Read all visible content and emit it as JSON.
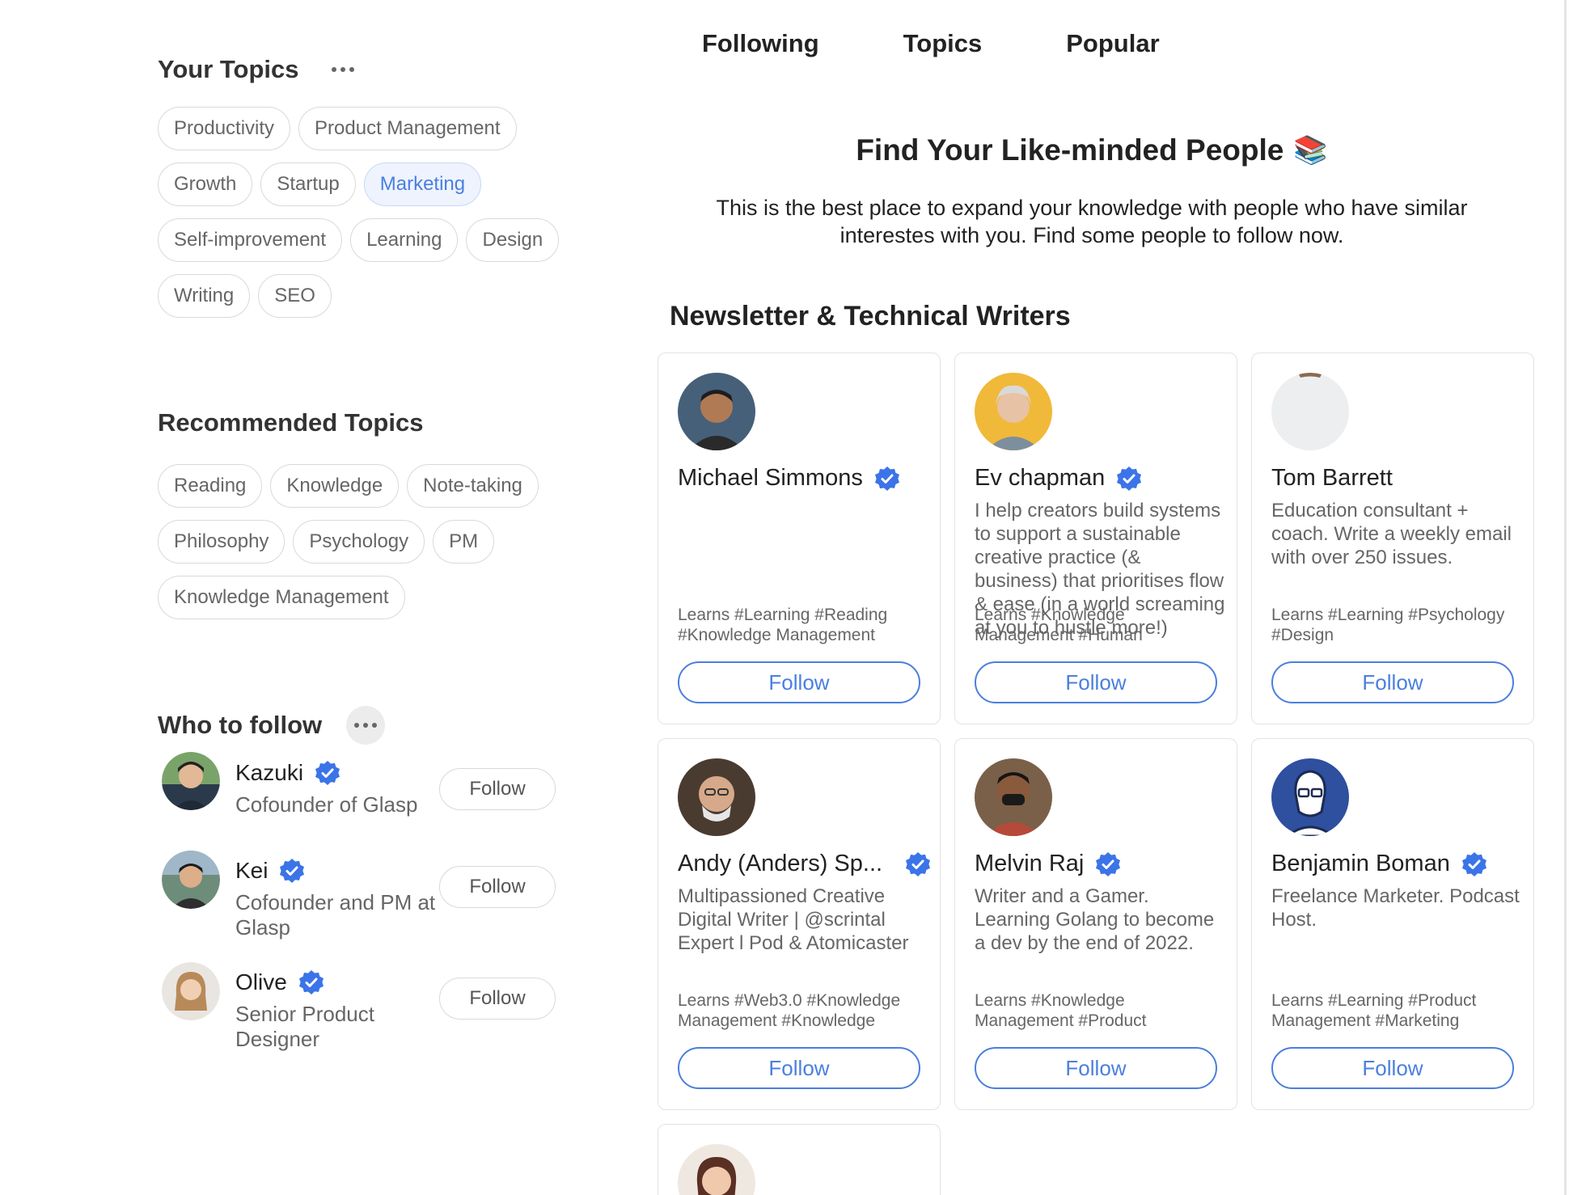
{
  "tabs": [
    "Following",
    "Topics",
    "Popular"
  ],
  "your_topics": {
    "title": "Your Topics",
    "chips": [
      "Productivity",
      "Product Management",
      "Growth",
      "Startup",
      "Marketing",
      "Self-improvement",
      "Learning",
      "Design",
      "Writing",
      "SEO"
    ],
    "active": "Marketing"
  },
  "recommended_topics": {
    "title": "Recommended Topics",
    "chips": [
      "Reading",
      "Knowledge",
      "Note-taking",
      "Philosophy",
      "Psychology",
      "PM",
      "Knowledge Management"
    ]
  },
  "who_to_follow": {
    "title": "Who to follow",
    "people": [
      {
        "name": "Kazuki",
        "desc": "Cofounder of Glasp",
        "button": "Follow"
      },
      {
        "name": "Kei",
        "desc": "Cofounder and PM at Glasp",
        "button": "Follow"
      },
      {
        "name": "Olive",
        "desc": "Senior Product Designer",
        "button": "Follow"
      }
    ]
  },
  "hero": {
    "title": "Find Your Like-minded People",
    "emoji": "📚",
    "subtitle": "This is the best place to expand your knowledge with people who have similar interestes with you. Find some people to follow now."
  },
  "section_title": "Newsletter & Technical Writers",
  "cards": [
    {
      "name": "Michael Simmons",
      "verified": true,
      "bio": "",
      "learns": "Learns #Learning #Reading #Knowledge Management",
      "button": "Follow"
    },
    {
      "name": "Ev chapman",
      "verified": true,
      "bio": "I help creators build systems to support a sustainable creative practice (& business) that prioritises flow & ease (in a world screaming at you to hustle more!)",
      "learns": "Learns #Knowledge Management #Human",
      "button": "Follow"
    },
    {
      "name": "Tom Barrett",
      "verified": false,
      "bio": "Education consultant + coach. Write a weekly email with over 250 issues.",
      "learns": "Learns #Learning #Psychology #Design",
      "button": "Follow"
    },
    {
      "name": "Andy (Anders) Sp...",
      "verified": true,
      "bio": "Multipassioned Creative Digital Writer | @scrintal Expert l Pod & Atomicaster",
      "learns": "Learns #Web3.0 #Knowledge Management #Knowledge",
      "button": "Follow"
    },
    {
      "name": "Melvin Raj",
      "verified": true,
      "bio": "Writer and a Gamer. Learning Golang to become a dev by the end of 2022.",
      "learns": "Learns #Knowledge Management #Product",
      "button": "Follow"
    },
    {
      "name": "Benjamin Boman",
      "verified": true,
      "bio": "Freelance Marketer. Podcast Host.",
      "learns": "Learns #Learning #Product Management #Marketing",
      "button": "Follow"
    }
  ],
  "colors": {
    "accent": "#4a7fe0",
    "verified": "#3b74e8",
    "chip_border": "#d9d9d9"
  }
}
